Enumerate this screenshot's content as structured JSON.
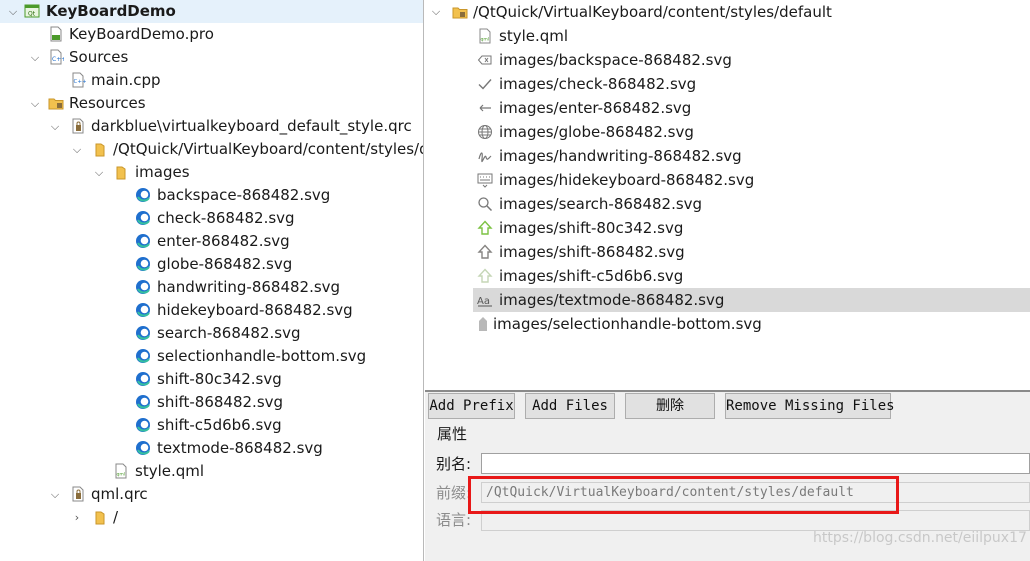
{
  "project_tree": {
    "root": "KeyBoardDemo",
    "pro_file": "KeyBoardDemo.pro",
    "sources": {
      "label": "Sources",
      "items": [
        "main.cpp"
      ]
    },
    "resources": {
      "label": "Resources",
      "qrc_default": "darkblue\\virtualkeyboard_default_style.qrc",
      "prefix_path": "/QtQuick/VirtualKeyboard/content/styles/default",
      "images_folder": "images",
      "images": [
        "backspace-868482.svg",
        "check-868482.svg",
        "enter-868482.svg",
        "globe-868482.svg",
        "handwriting-868482.svg",
        "hidekeyboard-868482.svg",
        "search-868482.svg",
        "selectionhandle-bottom.svg",
        "shift-80c342.svg",
        "shift-868482.svg",
        "shift-c5d6b6.svg",
        "textmode-868482.svg"
      ],
      "style_file": "style.qml",
      "qml_qrc": "qml.qrc",
      "qml_prefix": "/"
    }
  },
  "resource_editor": {
    "prefix": "/QtQuick/VirtualKeyboard/content/styles/default",
    "files": [
      {
        "name": "style.qml",
        "icon": "qml-file-icon"
      },
      {
        "name": "images/backspace-868482.svg",
        "icon": "backspace-icon"
      },
      {
        "name": "images/check-868482.svg",
        "icon": "check-icon"
      },
      {
        "name": "images/enter-868482.svg",
        "icon": "enter-icon"
      },
      {
        "name": "images/globe-868482.svg",
        "icon": "globe-icon"
      },
      {
        "name": "images/handwriting-868482.svg",
        "icon": "handwriting-icon"
      },
      {
        "name": "images/hidekeyboard-868482.svg",
        "icon": "keyboard-icon"
      },
      {
        "name": "images/search-868482.svg",
        "icon": "search-icon"
      },
      {
        "name": "images/shift-80c342.svg",
        "icon": "shift-green-icon"
      },
      {
        "name": "images/shift-868482.svg",
        "icon": "shift-gray-icon"
      },
      {
        "name": "images/shift-c5d6b6.svg",
        "icon": "shift-light-icon"
      },
      {
        "name": "images/textmode-868482.svg",
        "icon": "textmode-icon"
      },
      {
        "name": "images/selectionhandle-bottom.svg",
        "icon": "selectionhandle-icon"
      }
    ],
    "selected_index": 11,
    "buttons": {
      "add_prefix": "Add Prefix",
      "add_files": "Add Files",
      "delete": "删除",
      "remove_missing": "Remove Missing Files"
    },
    "properties": {
      "title": "属性",
      "alias_label": "别名:",
      "alias_value": "",
      "prefix_label": "前缀:",
      "prefix_value": "/QtQuick/VirtualKeyboard/content/styles/default",
      "language_label": "语言:",
      "language_value": ""
    }
  },
  "watermark": "https://blog.csdn.net/eiilpux17",
  "colors": {
    "selection_left": "#e5f1fb",
    "selection_right": "#d9d9d9",
    "highlight_box": "#e81818",
    "folder": "#f2c14e",
    "edge_blue": "#1f6fce",
    "shift_green": "#7cc242"
  }
}
